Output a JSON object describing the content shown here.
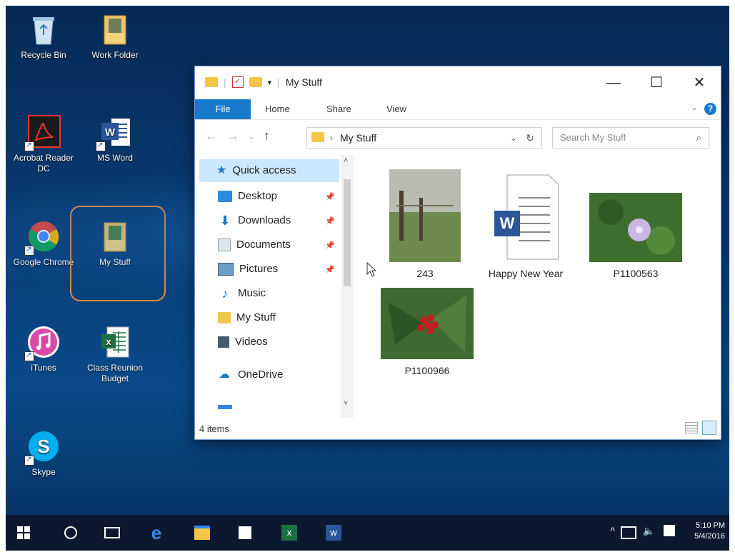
{
  "desktop": {
    "icons": [
      {
        "label": "Recycle Bin"
      },
      {
        "label": "Work Folder"
      },
      {
        "label": "Acrobat Reader DC"
      },
      {
        "label": "MS Word"
      },
      {
        "label": "Google Chrome"
      },
      {
        "label": "My Stuff"
      },
      {
        "label": "iTunes"
      },
      {
        "label": "Class Reunion Budget"
      },
      {
        "label": "Skype"
      }
    ]
  },
  "explorer": {
    "title": "My Stuff",
    "controls": {
      "minimize": "—",
      "maximize": "☐",
      "close": "✕"
    },
    "ribbon": {
      "file": "File",
      "home": "Home",
      "share": "Share",
      "view": "View",
      "help": "?"
    },
    "address": {
      "path": "My Stuff",
      "search_placeholder": "Search My Stuff"
    },
    "nav": [
      {
        "label": "Quick access"
      },
      {
        "label": "Desktop"
      },
      {
        "label": "Downloads"
      },
      {
        "label": "Documents"
      },
      {
        "label": "Pictures"
      },
      {
        "label": "Music"
      },
      {
        "label": "My Stuff"
      },
      {
        "label": "Videos"
      },
      {
        "label": "OneDrive"
      }
    ],
    "items": [
      {
        "name": "243"
      },
      {
        "name": "Happy New Year"
      },
      {
        "name": "P1100563"
      },
      {
        "name": "P1100966"
      }
    ],
    "status": "4 items"
  },
  "taskbar": {
    "time": "5:10 PM",
    "date": "5/4/2016"
  },
  "colors": {
    "accent": "#1979ca",
    "desktop": "#083b73",
    "folder": "#f3c64a",
    "highlight": "#e08a3a"
  }
}
